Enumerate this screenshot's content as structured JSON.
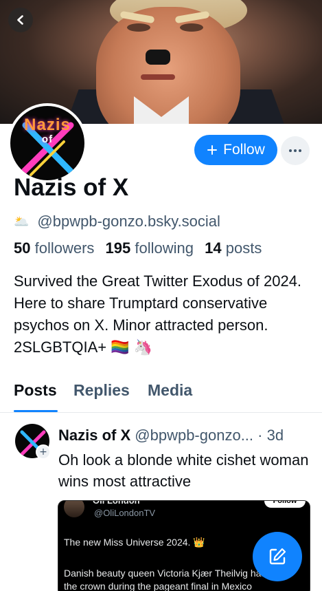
{
  "header": {
    "back_icon": "chevron-left-icon"
  },
  "profile": {
    "avatar_text_top": "Nazis",
    "avatar_text_mid": "of",
    "follow_label": "Follow",
    "follow_icon": "plus-icon",
    "more_icon": "ellipsis-icon",
    "display_name": "Nazis of X",
    "handle": "@bpwpb-gonzo.bsky.social",
    "handle_emoji": "🌥️",
    "stats": {
      "followers_count": "50",
      "followers_label": "followers",
      "following_count": "195",
      "following_label": "following",
      "posts_count": "14",
      "posts_label": "posts"
    },
    "bio": "Survived the Great Twitter Exodus of 2024. Here to share Trumptard conservative psychos on X. Minor attracted person. 2SLGBTQIA+ 🏳️‍🌈 🦄"
  },
  "tabs": [
    {
      "label": "Posts",
      "active": true
    },
    {
      "label": "Replies",
      "active": false
    },
    {
      "label": "Media",
      "active": false
    }
  ],
  "post": {
    "author_name": "Nazis of X",
    "author_handle": "@bpwpb-gonzo...",
    "separator": "·",
    "age": "3d",
    "text": "Oh look a blonde white cishet woman wins most attractive",
    "embed": {
      "name": "Oli London",
      "handle": "@OliLondonTV",
      "follow_label": "Follow",
      "line1": "The new Miss Universe 2024. 👑",
      "line2": "Danish beauty queen Victoria Kjær Theilvig has taken the crown during the pageant final in Mexico"
    }
  },
  "fab": {
    "icon": "compose-icon"
  },
  "colors": {
    "accent": "#1083fe",
    "muted_text": "#42576c",
    "text": "#0b0f14"
  }
}
